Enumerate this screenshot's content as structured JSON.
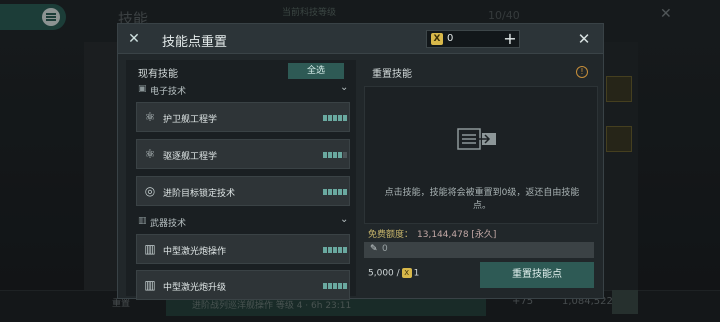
{
  "background": {
    "title": "技能",
    "progress_label": "当前科技等级",
    "count_label": "10/40",
    "bottom_label": "重置",
    "queue_text": "进阶战列巡洋舰操作 等级 4 · 6h 23:11",
    "bottom_num1": "+75",
    "bottom_num2": "1,084,522"
  },
  "modal": {
    "title": "技能点重置",
    "currency_value": "0",
    "plus_symbol": "+",
    "close_symbol": "✕",
    "left": {
      "label": "现有技能",
      "select_all": "全选",
      "categories": [
        {
          "label": "电子技术",
          "icon": "chip-icon"
        },
        {
          "label": "武器技术",
          "icon": "weapon-icon"
        }
      ],
      "skills": [
        {
          "name": "护卫舰工程学",
          "level": 5
        },
        {
          "name": "驱逐舰工程学",
          "level": 4
        },
        {
          "name": "进阶目标锁定技术",
          "level": 5
        },
        {
          "name": "中型激光炮操作",
          "level": 5
        },
        {
          "name": "中型激光炮升级",
          "level": 5
        }
      ]
    },
    "right": {
      "label": "重置技能",
      "alert": "!",
      "hint": "点击技能，技能将会被重置到0级，返还自由技能点。",
      "quota_label": "免费额度：",
      "quota_value": "13,144,478 [永久]",
      "points_value": "0",
      "cost_value": "5,000 /",
      "cost_currency": "1",
      "reset_button": "重置技能点"
    }
  },
  "colors": {
    "accent": "#2e5a55",
    "level_on": "#6aa9a0",
    "level_off": "#4c5558",
    "gold": "#d8b84a"
  }
}
